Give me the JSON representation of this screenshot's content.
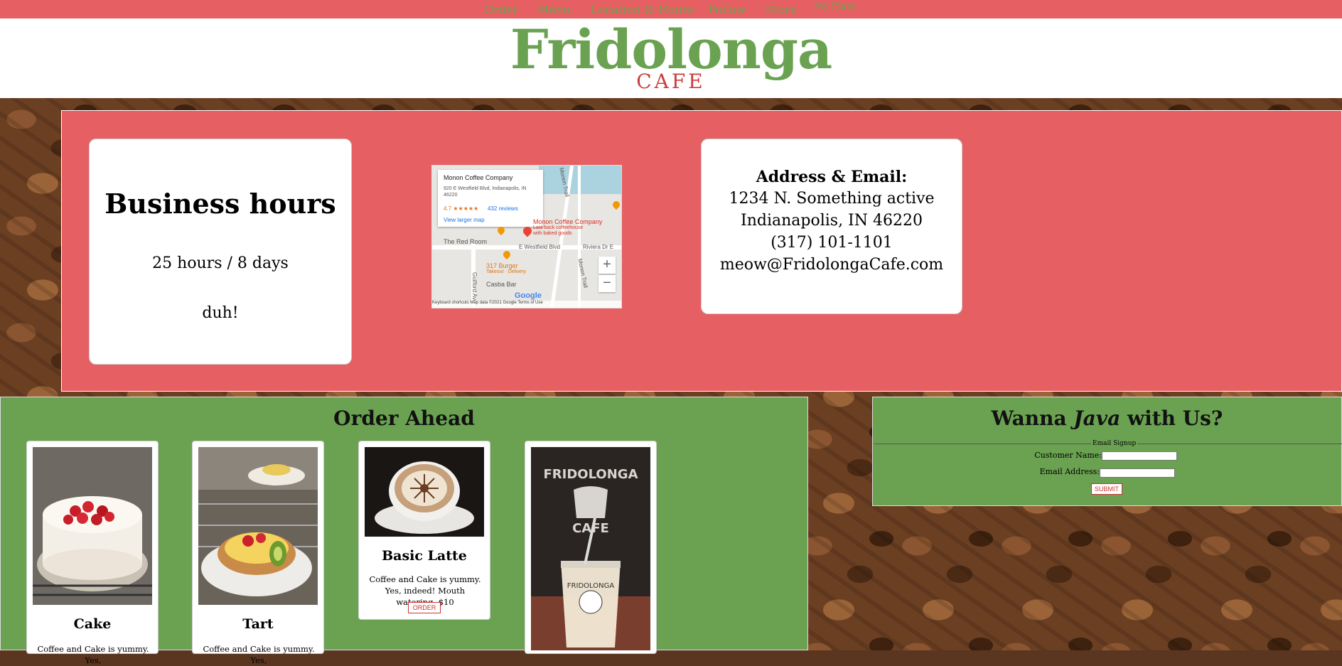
{
  "nav": {
    "items": [
      "Order",
      "Menu",
      "Location & Hours",
      "Follow",
      "Store"
    ],
    "my_plate": "My Plate"
  },
  "brand": {
    "name": "Fridolonga",
    "sub": "CAFE"
  },
  "hours": {
    "title": "Business hours",
    "line": "25 hours / 8 days",
    "note": "duh!"
  },
  "map": {
    "place_name": "Monon Coffee Company",
    "place_address": "920 E Westfield Blvd, Indianapolis, IN 46220",
    "rating": "4.7 ★★★★★",
    "reviews": "432 reviews",
    "view_larger": "View larger map",
    "labels": {
      "monon": "Monon Coffee Company",
      "monon_sub": "Laid-back coffeehouse with baked goods",
      "red_room": "The Red Room",
      "westfield": "E Westfield Blvd",
      "riviera": "Riviera Dr E",
      "burger": "317 Burger",
      "burger_sub": "Takeout · Delivery",
      "casba": "Casba Bar",
      "monon_trail": "Monon Trail",
      "monon_trail_2": "Monon Trail",
      "guilford": "Guilford Ave"
    },
    "zoom_in": "+",
    "zoom_out": "−",
    "footer": "Keyboard shortcuts   Map data ©2021 Google   Terms of Use",
    "google": "Google"
  },
  "address": {
    "title": "Address & Email:",
    "lines": [
      "1234 N. Something active",
      "Indianapolis, IN 46220",
      "(317) 101-1101",
      "meow@FridolongaCafe.com"
    ]
  },
  "order": {
    "title": "Order Ahead",
    "products": [
      {
        "name": "Cake",
        "desc": "Coffee and Cake is yummy. Yes,"
      },
      {
        "name": "Tart",
        "desc": "Coffee and Cake is yummy. Yes,"
      },
      {
        "name": "Basic Latte",
        "desc": "Coffee and Cake is yummy. Yes, indeed! Mouth watering. $10",
        "button": "ORDER"
      },
      {
        "name": "",
        "desc": ""
      }
    ]
  },
  "signup": {
    "title_pre": "Wanna ",
    "title_em": "Java",
    "title_post": " with Us?",
    "legend": "Email Signup",
    "name_label": "Customer Name:",
    "email_label": "Email Address:",
    "submit": "SUBMIT"
  },
  "colors": {
    "red": "#e65f62",
    "green": "#6aa251",
    "brand_red": "#cc3d3f"
  }
}
